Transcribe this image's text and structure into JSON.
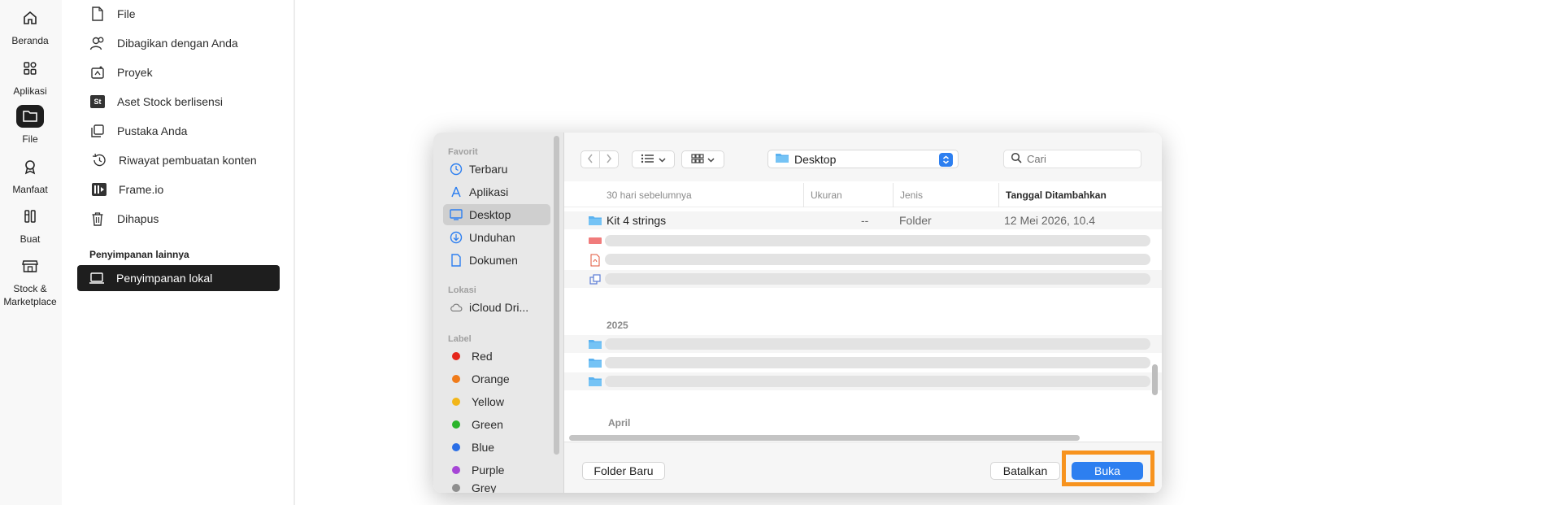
{
  "rail": {
    "items": [
      {
        "label": "Beranda",
        "icon": "home-icon"
      },
      {
        "label": "Aplikasi",
        "icon": "apps-icon"
      },
      {
        "label": "File",
        "icon": "folder-icon",
        "active": true
      },
      {
        "label": "Manfaat",
        "icon": "award-icon"
      },
      {
        "label": "Buat",
        "icon": "create-icon"
      },
      {
        "label": "Stock &",
        "label2": "Marketplace",
        "icon": "store-icon"
      }
    ]
  },
  "nav": {
    "items": [
      {
        "label": "File",
        "icon": "file-icon"
      },
      {
        "label": "Dibagikan dengan Anda",
        "icon": "shared-users-icon"
      },
      {
        "label": "Proyek",
        "icon": "project-icon"
      },
      {
        "label": "Aset Stock berlisensi",
        "icon": "stock-icon"
      },
      {
        "label": "Pustaka Anda",
        "icon": "library-icon"
      },
      {
        "label": "Riwayat pembuatan konten",
        "icon": "history-icon"
      },
      {
        "label": "Frame.io",
        "icon": "frameio-icon"
      },
      {
        "label": "Dihapus",
        "icon": "trash-icon"
      }
    ],
    "section_title": "Penyimpanan lainnya",
    "active_item": {
      "label": "Penyimpanan lokal",
      "icon": "laptop-icon"
    }
  },
  "dialog": {
    "sidebar": {
      "favorites_title": "Favorit",
      "favorites": [
        {
          "label": "Terbaru",
          "icon": "clock-icon"
        },
        {
          "label": "Aplikasi",
          "icon": "applications-icon"
        },
        {
          "label": "Desktop",
          "icon": "desktop-icon",
          "selected": true
        },
        {
          "label": "Unduhan",
          "icon": "download-icon"
        },
        {
          "label": "Dokumen",
          "icon": "document-icon"
        }
      ],
      "locations_title": "Lokasi",
      "locations": [
        {
          "label": "iCloud Dri...",
          "icon": "cloud-icon"
        }
      ],
      "labels_title": "Label",
      "labels": [
        {
          "label": "Red",
          "color": "#e5261b"
        },
        {
          "label": "Orange",
          "color": "#f07b1a"
        },
        {
          "label": "Yellow",
          "color": "#f2b619"
        },
        {
          "label": "Green",
          "color": "#2bb42b"
        },
        {
          "label": "Blue",
          "color": "#2a6ee6"
        },
        {
          "label": "Purple",
          "color": "#a646d6"
        },
        {
          "label": "Grey",
          "color": "#8e8e8e"
        }
      ]
    },
    "toolbar": {
      "path": "Desktop",
      "search_placeholder": "Cari"
    },
    "columns": {
      "name": "30 hari sebelumnya",
      "size": "Ukuran",
      "kind": "Jenis",
      "date": "Tanggal Ditambahkan"
    },
    "rows": [
      {
        "name": "Kit 4 strings",
        "size": "--",
        "kind": "Folder",
        "date": "12 Mei 2026, 10.4"
      }
    ],
    "groups": {
      "year": "2025",
      "month": "April"
    },
    "footer": {
      "new_folder": "Folder Baru",
      "cancel": "Batalkan",
      "open": "Buka"
    },
    "accent_color": "#2d7ff0",
    "highlight_color": "#f7931e"
  }
}
